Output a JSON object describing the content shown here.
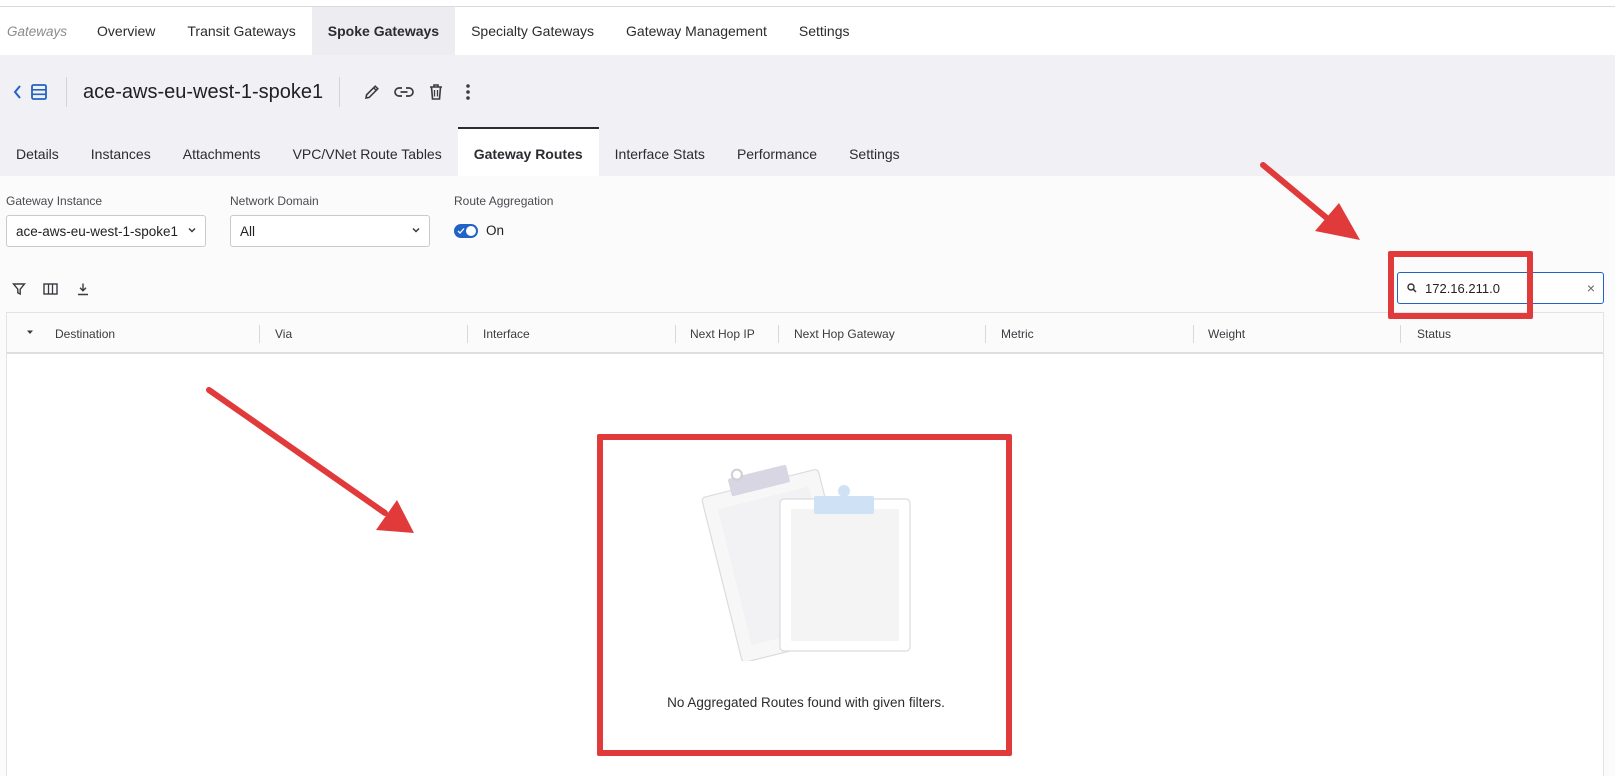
{
  "topnav": {
    "breadcrumb": "Gateways",
    "tabs": [
      {
        "label": "Overview"
      },
      {
        "label": "Transit Gateways"
      },
      {
        "label": "Spoke Gateways"
      },
      {
        "label": "Specialty Gateways"
      },
      {
        "label": "Gateway Management"
      },
      {
        "label": "Settings"
      }
    ],
    "active_tab": "Spoke Gateways"
  },
  "gateway": {
    "name": "ace-aws-eu-west-1-spoke1",
    "actions": [
      "edit-icon",
      "link-icon",
      "trash-icon",
      "more-vertical-icon"
    ]
  },
  "subtabs": {
    "tabs": [
      {
        "label": "Details"
      },
      {
        "label": "Instances"
      },
      {
        "label": "Attachments"
      },
      {
        "label": "VPC/VNet Route Tables"
      },
      {
        "label": "Gateway Routes"
      },
      {
        "label": "Interface Stats"
      },
      {
        "label": "Performance"
      },
      {
        "label": "Settings"
      }
    ],
    "active_tab": "Gateway Routes"
  },
  "filters": {
    "gateway_instance": {
      "label": "Gateway Instance",
      "value": "ace-aws-eu-west-1-spoke1"
    },
    "network_domain": {
      "label": "Network Domain",
      "value": "All"
    },
    "route_aggregation": {
      "label": "Route Aggregation",
      "state": "On",
      "enabled": true
    }
  },
  "toolbar": {
    "icons": [
      "filter-icon",
      "columns-icon",
      "download-icon"
    ]
  },
  "search": {
    "value": "172.16.211.0",
    "clear": "×"
  },
  "grid": {
    "columns": [
      "Destination",
      "Via",
      "Interface",
      "Next Hop IP",
      "Next Hop Gateway",
      "Metric",
      "Weight",
      "Status"
    ],
    "rows": [],
    "empty_message": "No Aggregated Routes found with given filters."
  },
  "colors": {
    "accent": "#2162c4",
    "annotation": "#e03a3a",
    "header_bg": "#f0f0f5"
  }
}
